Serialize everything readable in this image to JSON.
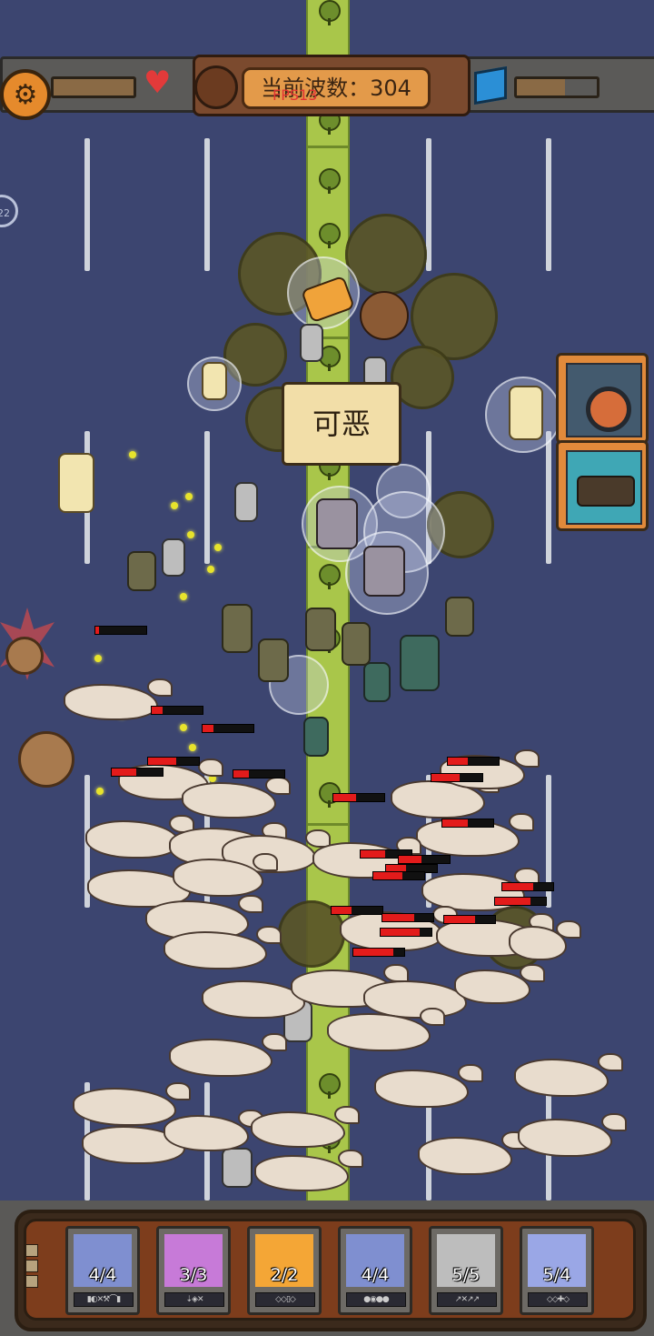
{
  "hud": {
    "wave_label": "当前波数：304",
    "fps": "FPS13",
    "side_badge": "22",
    "gear_glyph": "⚙",
    "heart_glyph": "♥"
  },
  "speech": {
    "text": "可恶"
  },
  "colors": {
    "field": "#3c4570",
    "road": "#a9c64a",
    "hud_orange": "#e39a4a",
    "health_red": "#e31b1b"
  },
  "units": [
    {
      "id": "gunner",
      "count": "4/4",
      "tags": "▮◐✕⚒⌒▮",
      "bg": "#7f8fd0",
      "icon": "gunner-icon"
    },
    {
      "id": "grenadier",
      "count": "3/3",
      "tags": "⇣◈✕",
      "bg": "#c77ad8",
      "icon": "grenadier-icon"
    },
    {
      "id": "monk",
      "count": "2/2",
      "tags": "◇◇▯◇",
      "bg": "#f4a636",
      "icon": "monk-icon"
    },
    {
      "id": "brawler",
      "count": "4/4",
      "tags": "●◉●●",
      "bg": "#7f8fd0",
      "icon": "brawler-icon"
    },
    {
      "id": "crossbow",
      "count": "5/5",
      "tags": "↗✕↗↗",
      "bg": "#bdbdbd",
      "icon": "crossbow-icon"
    },
    {
      "id": "priestess",
      "count": "5/4",
      "tags": "◇◇✚◇",
      "bg": "#9aa7e6",
      "icon": "priestess-icon"
    }
  ]
}
